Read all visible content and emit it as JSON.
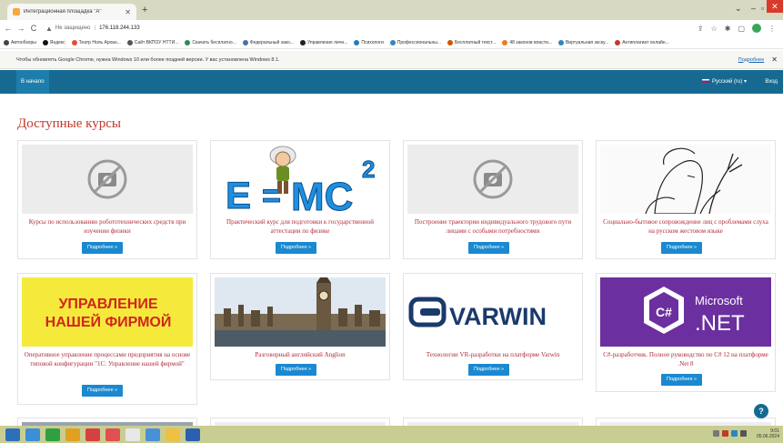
{
  "browser": {
    "tab_title": "Интеграционная площадка \"А\"",
    "tab_close": "✕",
    "new_tab": "+",
    "nav": {
      "back": "←",
      "forward": "→",
      "reload": "C"
    },
    "address": {
      "security_label": "Не защищено",
      "url": "176.118.244.133"
    },
    "bookmarks": [
      {
        "label": "Автообзоры",
        "color": "#444"
      },
      {
        "label": "Яндекс",
        "color": "#111"
      },
      {
        "label": "Театр Ноль Архан...",
        "color": "#e74c3c"
      },
      {
        "label": "Сайт ВКПОУ НТТИ...",
        "color": "#555"
      },
      {
        "label": "Скачать бесплатно...",
        "color": "#2e8b57"
      },
      {
        "label": "Федеральный зако...",
        "color": "#4a6fa5"
      },
      {
        "label": "Управление личн...",
        "color": "#222"
      },
      {
        "label": "Психологи",
        "color": "#2a7ab8"
      },
      {
        "label": "Профессиональны...",
        "color": "#3a82c4"
      },
      {
        "label": "Бесплатный текст...",
        "color": "#d35400"
      },
      {
        "label": "48 законов власти...",
        "color": "#e67e22"
      },
      {
        "label": "Виртуальная экску...",
        "color": "#2e86c1"
      },
      {
        "label": "Антиплагиат онлайн...",
        "color": "#c0392b"
      }
    ],
    "infobar": {
      "message": "Чтобы обновлять Google Chrome, нужна Windows 10 или более поздней версии. У вас установлена Windows 8.1.",
      "link": "Подробнее",
      "close": "✕"
    }
  },
  "site": {
    "home_label": "В начало",
    "language_label": "Русский (ru) ▾",
    "login_label": "Вход",
    "page_title": "Доступные курсы",
    "more_label": "Подробнее »",
    "help": "?"
  },
  "courses": [
    {
      "title": "Курсы по использованию робототехнических средств при изучении физики",
      "image": "placeholder-camera"
    },
    {
      "title": "Практический курс для подготовки к государственной аттестации по физике",
      "image": "e-mc2-cartoon"
    },
    {
      "title": "Построение траектории индивидуального трудового пути лицами с особыми потребностями",
      "image": "placeholder-camera"
    },
    {
      "title": "Социально-бытовое сопровождение лиц с проблемами слуха на русском жестовом языке",
      "image": "sign-language-sketch"
    },
    {
      "title": "Оперативное управление процессами предприятия на основе типовой конфигурации \"1С: Управление нашей фирмой\"",
      "image": "yellow-banner",
      "banner_text": [
        "УПРАВЛЕНИЕ",
        "НАШЕЙ ФИРМОЙ"
      ]
    },
    {
      "title": "Разговорный английский Anglion",
      "image": "london-big-ben"
    },
    {
      "title": "Технологии VR-разработки на платформе Varwin",
      "image": "varwin-logo",
      "logo_text": "VARWIN"
    },
    {
      "title": "C#-разработчик. Полное руководство по C# 12 на платформе .Net 8",
      "image": "dotnet-logo",
      "logo_text": [
        "Microsoft",
        ".NET"
      ],
      "badge": "C#"
    }
  ],
  "image_text": {
    "formula_e": "E",
    "formula_eq": "=",
    "formula_mc": "MC",
    "formula_sup": "2"
  },
  "taskbar": {
    "time": "9:01",
    "date": "05.06.2024"
  },
  "colors": {
    "accent": "#166a92",
    "title_red": "#c0392b",
    "button_blue": "#1a89d0"
  }
}
